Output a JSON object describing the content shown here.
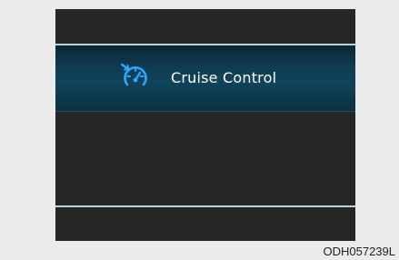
{
  "display": {
    "message": {
      "icon": "cruise-control-speedometer-icon",
      "label": "Cruise Control"
    },
    "colors": {
      "background": "#262626",
      "banner": "#10445c",
      "divider": "#b9d2dc",
      "text": "#ffffff"
    }
  },
  "figure": {
    "code": "ODH057239L"
  }
}
